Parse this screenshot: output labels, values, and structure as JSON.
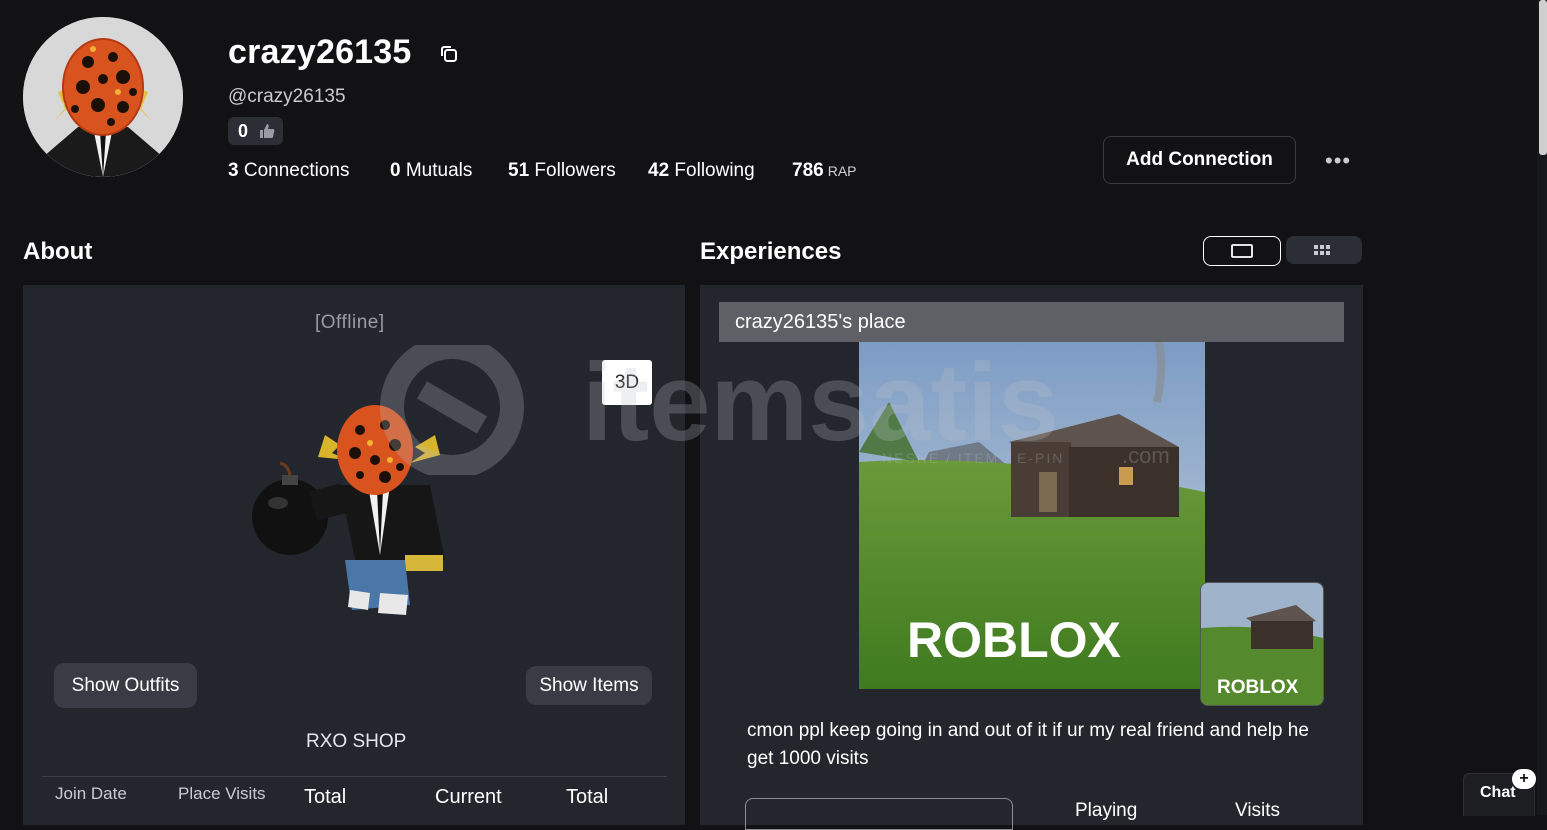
{
  "profile": {
    "display_name": "crazy26135",
    "handle": "@crazy26135",
    "likes": "0"
  },
  "stats": [
    {
      "value": "3",
      "label": "Connections"
    },
    {
      "value": "0",
      "label": "Mutuals"
    },
    {
      "value": "51",
      "label": "Followers"
    },
    {
      "value": "42",
      "label": "Following"
    },
    {
      "value": "786",
      "label": "RAP"
    }
  ],
  "actions": {
    "add_connection": "Add Connection",
    "more": "•••"
  },
  "about": {
    "title": "About",
    "status": "[Offline]",
    "btn_3d": "3D",
    "show_outfits": "Show Outfits",
    "show_items": "Show Items",
    "shop_label": "RXO SHOP",
    "columns": [
      "Join Date",
      "Place Visits",
      "Total",
      "Current",
      "Total"
    ]
  },
  "experiences": {
    "title": "Experiences",
    "place_title": "crazy26135's place",
    "thumbnail_brand": "ROBLOX",
    "description": "cmon ppl keep going in and out of it if ur my real friend and help he get 1000 visits",
    "col_playing": "Playing",
    "col_visits": "Visits"
  },
  "watermark": {
    "brand": "itemsatis",
    "tagline": "NESNE / ITEM / E-PIN",
    "suffix": ".com"
  },
  "chat": {
    "label": "Chat",
    "badge": "+"
  },
  "colors": {
    "background": "#121215",
    "panel": "#24262d",
    "button": "#3a3c45"
  }
}
